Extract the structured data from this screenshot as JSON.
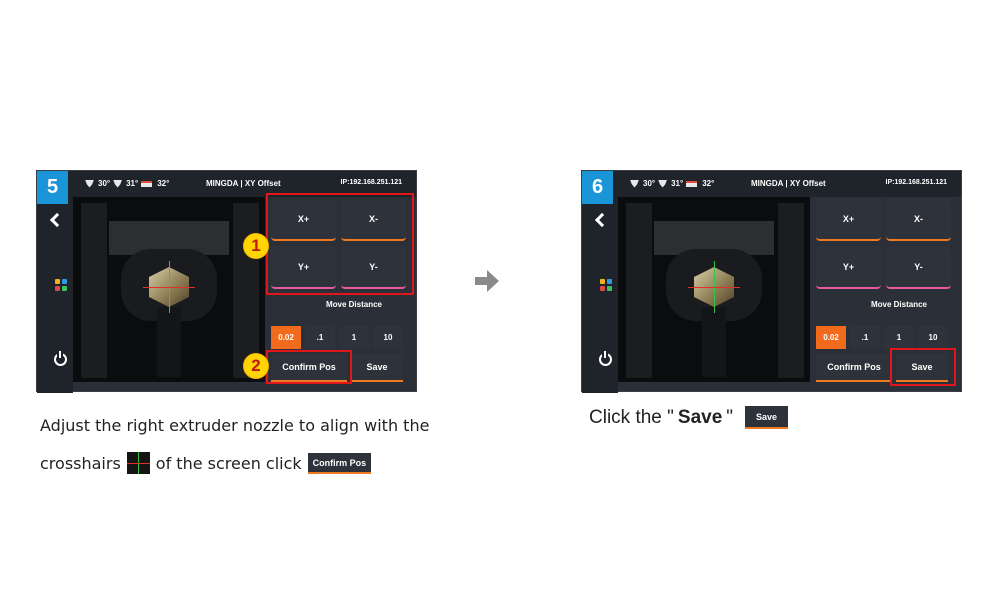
{
  "steps": [
    {
      "number": "5",
      "status": {
        "nozzle_left_temp": "30°",
        "nozzle_right_temp": "31°",
        "bed_temp": "32°",
        "title": "MINGDA | XY Offset",
        "ip": "IP:192.168.251.121"
      },
      "controls": {
        "x_plus": "X+",
        "x_minus": "X-",
        "y_plus": "Y+",
        "y_minus": "Y-",
        "move_distance_label": "Move Distance",
        "distances": [
          "0.02",
          ".1",
          "1",
          "10"
        ],
        "selected_distance": "0.02",
        "confirm_label": "Confirm Pos",
        "save_label": "Save"
      },
      "markers": [
        "1",
        "2"
      ]
    },
    {
      "number": "6",
      "status": {
        "nozzle_left_temp": "30°",
        "nozzle_right_temp": "31°",
        "bed_temp": "32°",
        "title": "MINGDA | XY Offset",
        "ip": "IP:192.168.251.121"
      },
      "controls": {
        "x_plus": "X+",
        "x_minus": "X-",
        "y_plus": "Y+",
        "y_minus": "Y-",
        "move_distance_label": "Move Distance",
        "distances": [
          "0.02",
          ".1",
          "1",
          "10"
        ],
        "selected_distance": "0.02",
        "confirm_label": "Confirm Pos",
        "save_label": "Save"
      }
    }
  ],
  "captions": {
    "step5_line1": "Adjust the right extruder nozzle to align with the",
    "step5_line2_a": "crosshairs",
    "step5_line2_b": "of the screen click",
    "step5_button": "Confirm Pos",
    "step6_a": "Click the \"",
    "step6_bold": "Save",
    "step6_b": "\"",
    "step6_button": "Save"
  },
  "colors": {
    "accent_orange": "#f26a1b",
    "step_badge_blue": "#1a96d8",
    "highlight_red": "#e0161b",
    "marker_yellow": "#ffd400"
  },
  "icons": [
    "back-icon",
    "app-grid-icon",
    "power-icon",
    "nozzle-temp-icon",
    "bed-temp-icon",
    "right-arrow-icon",
    "crosshair-icon"
  ]
}
